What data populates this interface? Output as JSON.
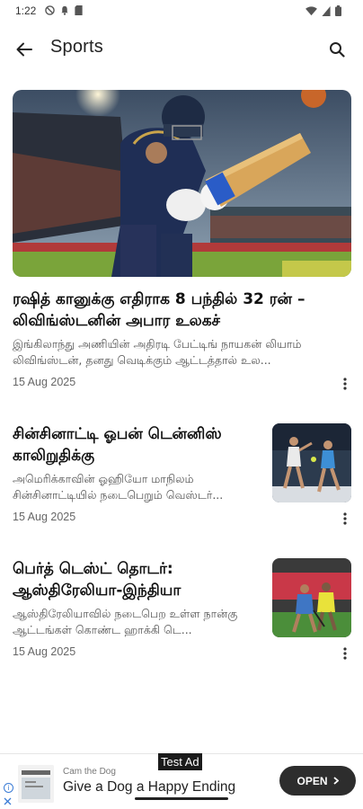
{
  "status_bar": {
    "time": "1:22"
  },
  "app_bar": {
    "title": "Sports",
    "icons": {
      "back": "arrow-back-icon",
      "search": "search-icon"
    }
  },
  "featured": {
    "title": "ரஷித் கானுக்கு எதிராக 8 பந்தில் 32 ரன் – லிவிங்ஸ்டனின் அபார உலகச்",
    "summary": "இங்கிலாந்து அணியின் அதிரடி பேட்டிங் நாயகன் லியாம் லிவிங்ஸ்டன், தனது வெடிக்கும் ஆட்டத்தால் உல...",
    "date": "15 Aug 2025",
    "image_alt": "cricket-batsman-image"
  },
  "articles": [
    {
      "title": "சின்சினாட்டி ஓபன் டென்னிஸ் காலிறுதிக்கு",
      "summary": "அமெரிக்காவின் ஓஹியோ மாநிலம் சின்சினாட்டியில் நடைபெறும் வெஸ்டர்...",
      "date": "15 Aug 2025"
    },
    {
      "title": "பெர்த் டெஸ்ட் தொடர்: ஆஸ்திரேலியா-இந்தியா",
      "summary": "ஆஸ்திரேலியாவில் நடைபெற உள்ள நான்கு ஆட்டங்கள் கொண்ட ஹாக்கி டெ...",
      "date": "15 Aug 2025"
    }
  ],
  "ad": {
    "label": "Test Ad",
    "advertiser": "Cam the Dog",
    "headline": "Give a Dog a Happy Ending",
    "cta": "OPEN",
    "info": "i"
  },
  "colors": {
    "ad_cta_bg": "#2d2d2d",
    "ad_info": "#3a7bd5"
  }
}
